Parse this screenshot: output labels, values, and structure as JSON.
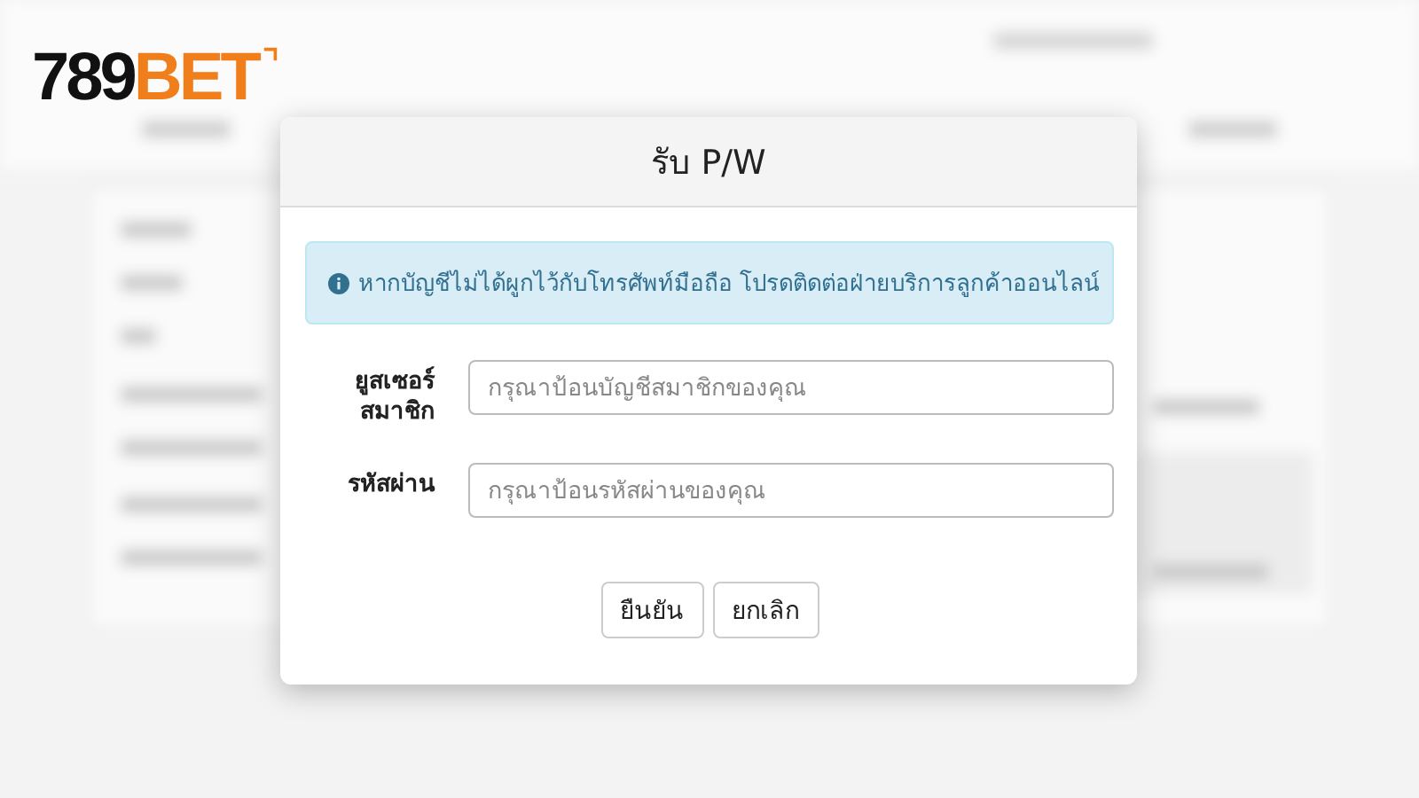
{
  "logo": {
    "number": "789",
    "word": "BET"
  },
  "dialog": {
    "title": "รับ P/W",
    "alert": "หากบัญชีไม่ได้ผูกไว้กับโทรศัพท์มือถือ โปรดติดต่อฝ่ายบริการลูกค้าออนไลน์",
    "fields": [
      {
        "label": "ยูสเซอร์ สมาชิก",
        "placeholder": "กรุณาป้อนบัญชีสมาชิกของคุณ"
      },
      {
        "label": "รหัสผ่าน",
        "placeholder": "กรุณาป้อนรหัสผ่านของคุณ"
      }
    ],
    "buttons": [
      "ยืนยัน",
      "ยกเลิก"
    ]
  }
}
